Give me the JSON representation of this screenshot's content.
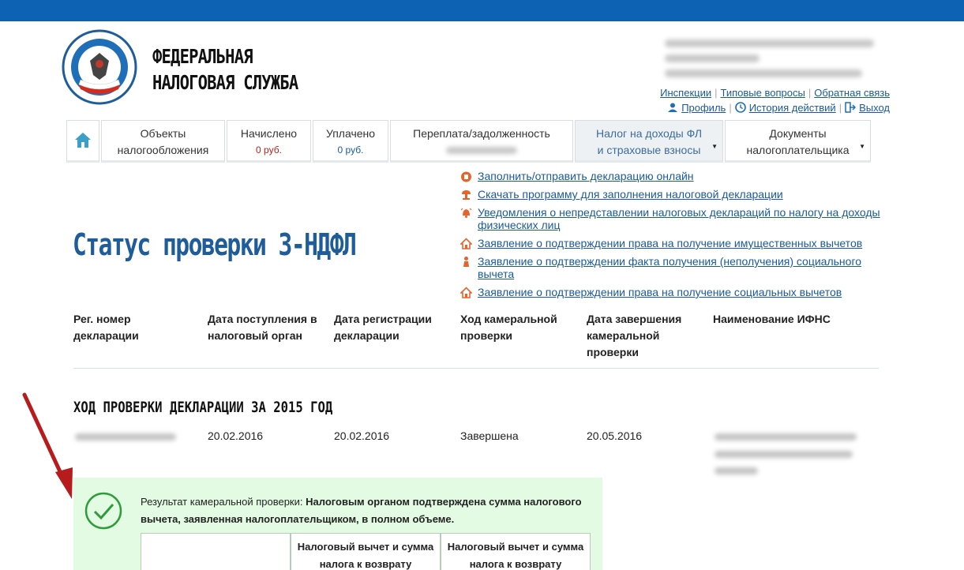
{
  "header": {
    "brand_line1": "ФЕДЕРАЛЬНАЯ",
    "brand_line2": "НАЛОГОВАЯ СЛУЖБА",
    "logo_icon": "fns-emblem-icon"
  },
  "toplinks": {
    "inspections": "Инспекции",
    "faq": "Типовые вопросы",
    "feedback": "Обратная связь",
    "profile": "Профиль",
    "history": "История действий",
    "logout": "Выход"
  },
  "nav": {
    "tabs": [
      {
        "line1": "Объекты",
        "line2": "налогообложения"
      },
      {
        "line1": "Начислено",
        "line2": "0 руб."
      },
      {
        "line1": "Уплачено",
        "line2": "0 руб."
      },
      {
        "line1": "Переплата/задолженность",
        "line2": ""
      },
      {
        "line1": "Налог на доходы ФЛ",
        "line2": "и страховые взносы"
      },
      {
        "line1": "Документы",
        "line2": "налогоплательщика"
      }
    ]
  },
  "sidelinks": [
    "Заполнить/отправить декларацию онлайн",
    "Скачать программу для заполнения налоговой декларации",
    "Уведомления о непредставлении налоговых деклараций по налогу на доходы физических лиц",
    "Заявление о подтверждении права на получение имущественных вычетов",
    "Заявление о подтверждении факта получения (неполучения) социального вычета",
    "Заявление о подтверждении права на получение социальных вычетов"
  ],
  "page_title": "Статус проверки 3-НДФЛ",
  "table": {
    "headers": [
      "Рег. номер декларации",
      "Дата поступления в налоговый орган",
      "Дата регистрации декларации",
      "Ход камеральной проверки",
      "Дата завершения камеральной проверки",
      "Наименование ИФНС"
    ],
    "section_title": "ХОД ПРОВЕРКИ ДЕКЛАРАЦИИ ЗА 2015 ГОД",
    "row": {
      "received": "20.02.2016",
      "registered": "20.02.2016",
      "status": "Завершена",
      "completed": "20.05.2016"
    }
  },
  "result": {
    "label": "Результат камеральной проверки:",
    "text": "Налоговым органом подтверждена сумма налогового вычета, заявленная налогоплательщиком, в полном объеме.",
    "col1": "Налоговый вычет и сумма налога к возврату",
    "col2": "Налоговый вычет и сумма налога к возврату"
  },
  "colors": {
    "brand_blue": "#0e62b4",
    "title_blue": "#1e5d9a",
    "link_blue": "#1a5a9a",
    "result_bg": "#e3fbe3",
    "check_green": "#2e9c3a",
    "arrow_red": "#b71c1c"
  }
}
